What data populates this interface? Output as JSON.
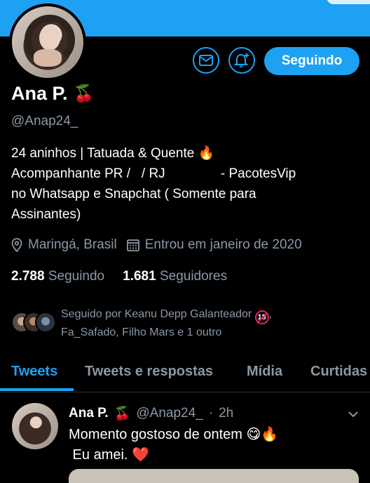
{
  "profile": {
    "name": "Ana P.",
    "name_emoji": "🍒",
    "handle": "@Anap24_",
    "bio_lines": [
      "24 aninhos | Tatuada & Quente 🔥",
      "Acompanhante PR /   / RJ               - PacotesVip",
      "no Whatsapp e Snapchat ( Somente para",
      "Assinantes)"
    ],
    "location": "Maringá, Brasil",
    "joined": "Entrou em janeiro de 2020",
    "following_count": "2.788",
    "following_label": "Seguindo",
    "followers_count": "1.681",
    "followers_label": "Seguidores",
    "followed_by_line1": "Seguido por Keanu Depp Galanteador",
    "followed_by_badge": "18",
    "followed_by_line1_end": ",",
    "followed_by_line2": "Fa_Safado, Filho Mars e 1 outro"
  },
  "actions": {
    "follow_label": "Seguindo"
  },
  "tabs": [
    {
      "label": "Tweets",
      "active": true
    },
    {
      "label": "Tweets e respostas",
      "active": false
    },
    {
      "label": "Mídia",
      "active": false
    },
    {
      "label": "Curtidas",
      "active": false
    }
  ],
  "tweet": {
    "author": "Ana P.",
    "author_emoji": "🍒",
    "handle": "@Anap24_",
    "separator": "·",
    "time": "2h",
    "line1": "Momento gostoso de ontem 😋🔥",
    "line2": " Eu amei. ❤️"
  },
  "colors": {
    "accent": "#1da1f2",
    "background": "#000000",
    "muted": "#8b98a5",
    "text": "#ffffff"
  },
  "icons": [
    "mail-icon",
    "bell-plus-icon",
    "location-icon",
    "calendar-icon",
    "chevron-down-icon"
  ]
}
